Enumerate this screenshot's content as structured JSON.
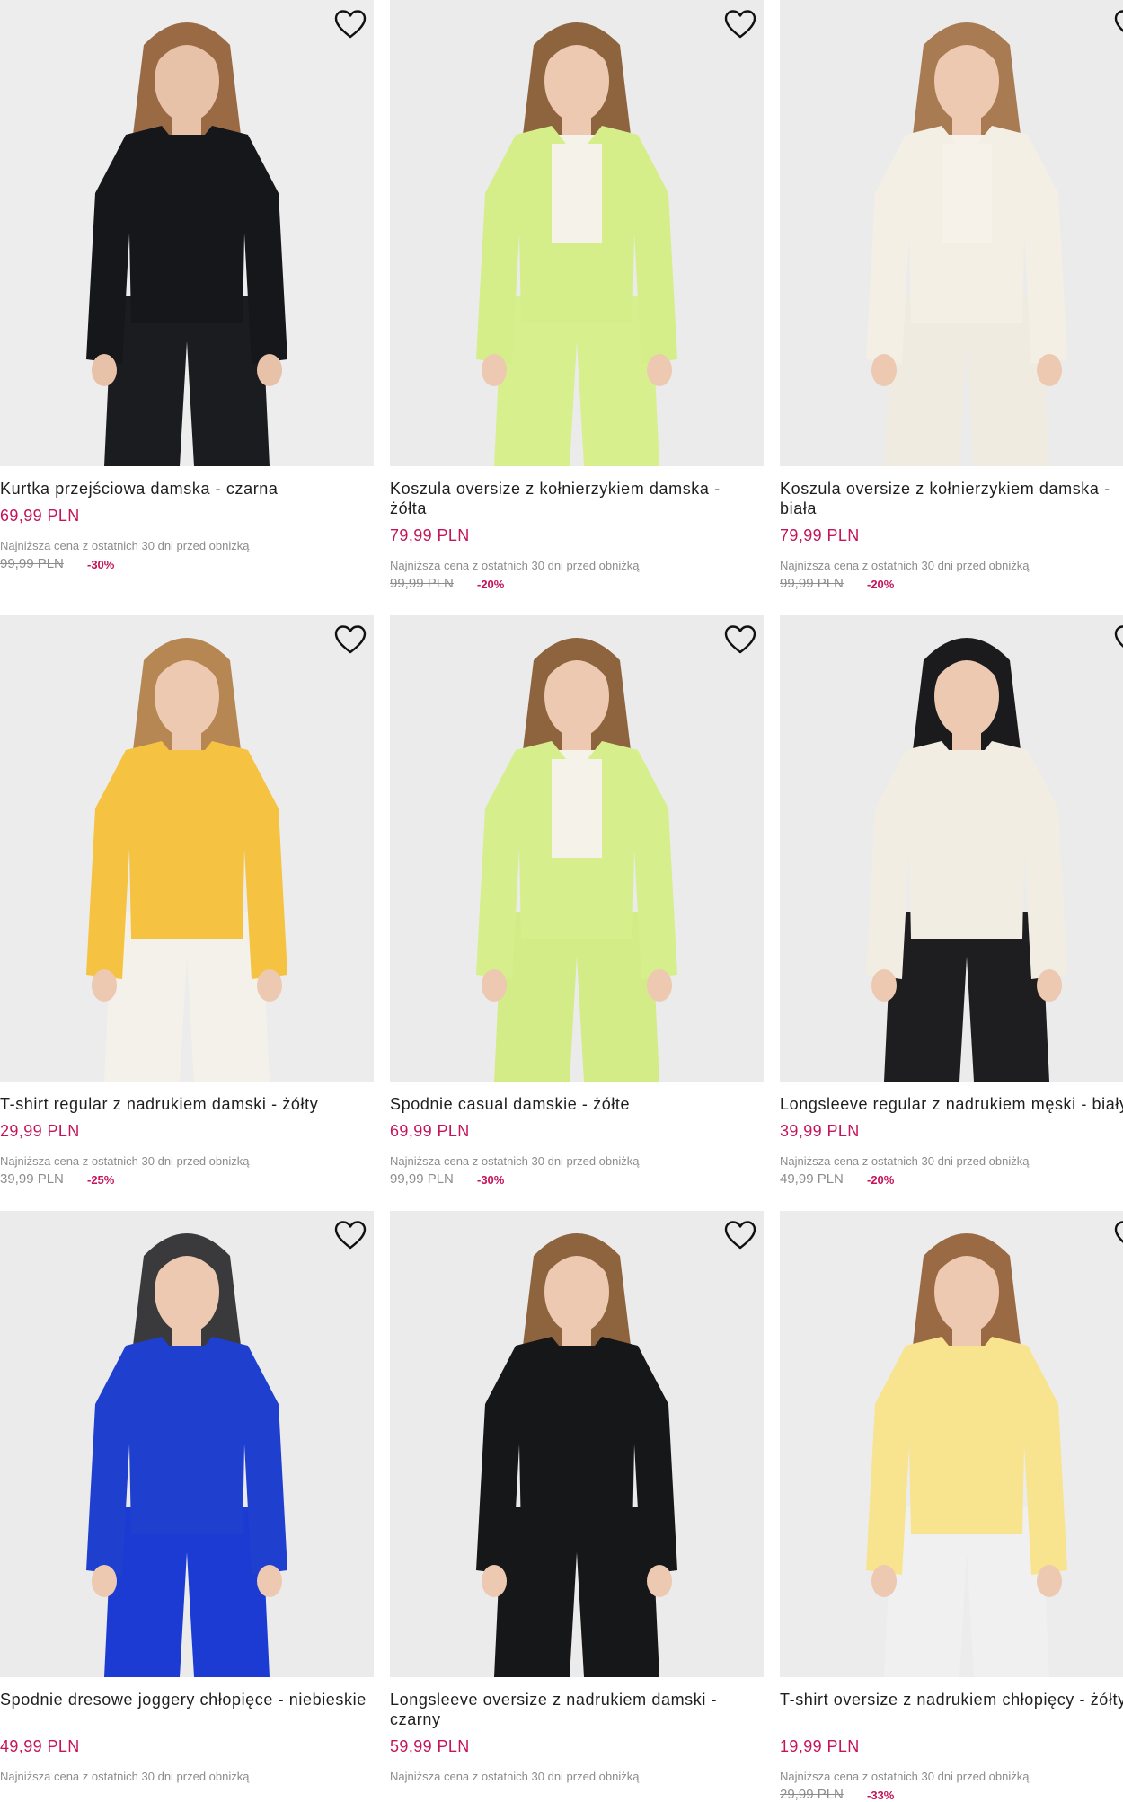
{
  "products": [
    {
      "title": "Kurtka przejściowa damska - czarna",
      "price": "69,99 PLN",
      "lowest_label": "Najniższa cena z ostatnich 30 dni przed obniżką",
      "old_price": "99,99 PLN",
      "discount": "-30%",
      "colors": {
        "top": "#15171a",
        "bottom": "#1b1c20",
        "inner": "#15171a",
        "skin": "#e8c2a8",
        "hair": "#9a6a44",
        "bg": "#ededed"
      }
    },
    {
      "title": "Koszula oversize z kołnierzykiem damska - żółta",
      "price": "79,99 PLN",
      "lowest_label": "Najniższa cena z ostatnich 30 dni przed obniżką",
      "old_price": "99,99 PLN",
      "discount": "-20%",
      "colors": {
        "top": "#d5ee8a",
        "bottom": "#d8ef8e",
        "inner": "#f5f2ea",
        "skin": "#ecc9b0",
        "hair": "#8e643f",
        "bg": "#ebebeb"
      }
    },
    {
      "title": "Koszula oversize z kołnierzykiem damska - biała",
      "price": "79,99 PLN",
      "lowest_label": "Najniższa cena z ostatnich 30 dni przed obniżką",
      "old_price": "99,99 PLN",
      "discount": "-20%",
      "colors": {
        "top": "#f3efe4",
        "bottom": "#f0ebe0",
        "inner": "#f6f2ea",
        "skin": "#ecc9b0",
        "hair": "#a87b52",
        "bg": "#ebebeb"
      }
    },
    {
      "title": "T-shirt regular z nadrukiem damski - żółty",
      "price": "29,99 PLN",
      "lowest_label": "Najniższa cena z ostatnich 30 dni przed obniżką",
      "old_price": "39,99 PLN",
      "discount": "-25%",
      "colors": {
        "top": "#f5c241",
        "bottom": "#f4f1ea",
        "inner": "#f5c241",
        "skin": "#ecc9b0",
        "hair": "#b68653",
        "bg": "#ececec"
      }
    },
    {
      "title": "Spodnie casual damskie - żółte",
      "price": "69,99 PLN",
      "lowest_label": "Najniższa cena z ostatnich 30 dni przed obniżką",
      "old_price": "99,99 PLN",
      "discount": "-30%",
      "colors": {
        "top": "#d6ee8c",
        "bottom": "#d4ec88",
        "inner": "#f5f2ea",
        "skin": "#ecc9b0",
        "hair": "#8e643f",
        "bg": "#ebebeb"
      }
    },
    {
      "title": "Longsleeve regular z nadrukiem męski - biały",
      "price": "39,99 PLN",
      "lowest_label": "Najniższa cena z ostatnich 30 dni przed obniżką",
      "old_price": "49,99 PLN",
      "discount": "-20%",
      "colors": {
        "top": "#f1ede3",
        "bottom": "#1e1e20",
        "inner": "#f1ede3",
        "skin": "#ecc9b0",
        "hair": "#1b1b1d",
        "bg": "#ebebeb"
      }
    },
    {
      "title": "Spodnie dresowe joggery chłopięce - niebieskie",
      "price": "49,99 PLN",
      "lowest_label": "Najniższa cena z ostatnich 30 dni przed obniżką",
      "old_price": "",
      "discount": "",
      "colors": {
        "top": "#1f3fcf",
        "bottom": "#1c3bd2",
        "inner": "#1f3fcf",
        "skin": "#ecc9b0",
        "hair": "#3a3a3c",
        "bg": "#ebebeb"
      }
    },
    {
      "title": "Longsleeve oversize z nadrukiem damski - czarny",
      "price": "59,99 PLN",
      "lowest_label": "Najniższa cena z ostatnich 30 dni przed obniżką",
      "old_price": "",
      "discount": "",
      "colors": {
        "top": "#161719",
        "bottom": "#161719",
        "inner": "#161719",
        "skin": "#ecc9b0",
        "hair": "#8e643f",
        "bg": "#ebebeb"
      }
    },
    {
      "title": "T-shirt oversize z nadrukiem chłopięcy - żółty",
      "price": "19,99 PLN",
      "lowest_label": "Najniższa cena z ostatnich 30 dni przed obniżką",
      "old_price": "29,99 PLN",
      "discount": "-33%",
      "colors": {
        "top": "#f8e38e",
        "bottom": "#f0f0f0",
        "inner": "#f8e38e",
        "skin": "#ecc9b0",
        "hair": "#9a6a44",
        "bg": "#ececec"
      }
    }
  ],
  "icons": {
    "wishlist": "heart-outline-icon"
  },
  "accent_color": "#c4145a"
}
